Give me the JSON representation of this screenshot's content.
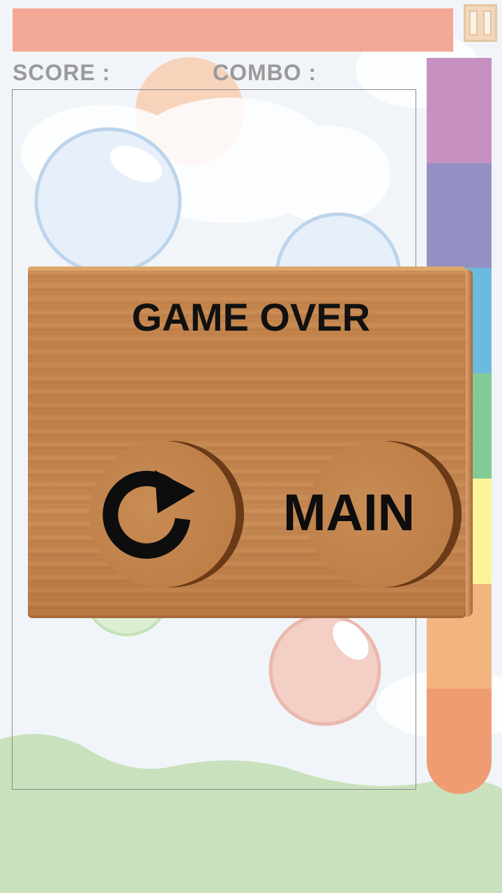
{
  "hud": {
    "score_label": "SCORE :",
    "combo_label": "COMBO :"
  },
  "dialog": {
    "title": "GAME OVER",
    "main_button": "MAIN",
    "retry_icon": "retry-arrow-icon"
  },
  "pause_icon": "pause-icon",
  "colors": {
    "top_bar": "#f4a896",
    "meter": [
      "#c690c0",
      "#9590c3",
      "#6bbbe0",
      "#84ca95",
      "#fbf49a",
      "#f3b57f",
      "#f09c72"
    ],
    "wood": "#c48650"
  }
}
